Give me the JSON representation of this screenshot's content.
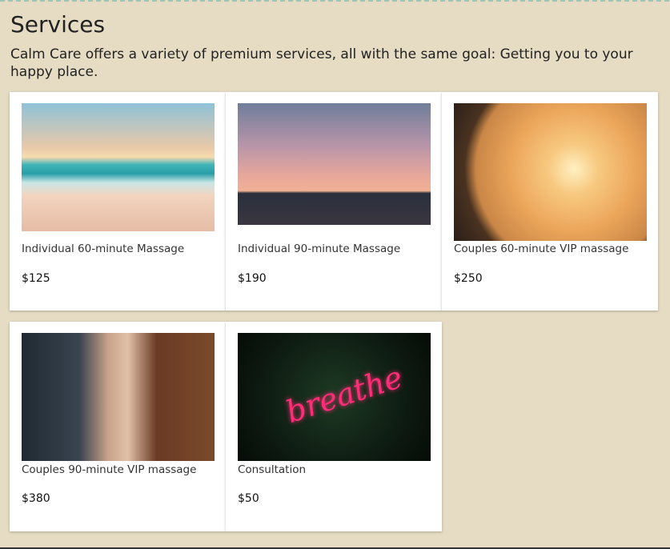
{
  "page": {
    "title": "Services",
    "intro": "Calm Care offers a variety of premium services, all with the same goal: Getting you to your happy place."
  },
  "services": [
    {
      "name": "Individual 60-minute Massage",
      "price": "$125",
      "image": "beach-sunset-image"
    },
    {
      "name": "Individual 90-minute Massage",
      "price": "$190",
      "image": "yoga-silhouette-image"
    },
    {
      "name": "Couples 60-minute VIP massage",
      "price": "$250",
      "image": "couple-sunset-image"
    },
    {
      "name": "Couples 90-minute VIP massage",
      "price": "$380",
      "image": "woman-portrait-image"
    },
    {
      "name": "Consultation",
      "price": "$50",
      "image": "breathe-neon-image",
      "neon_text": "breathe"
    }
  ],
  "colors": {
    "background": "#e5dcc3",
    "card": "#ffffff",
    "neon": "#ff2d78"
  }
}
